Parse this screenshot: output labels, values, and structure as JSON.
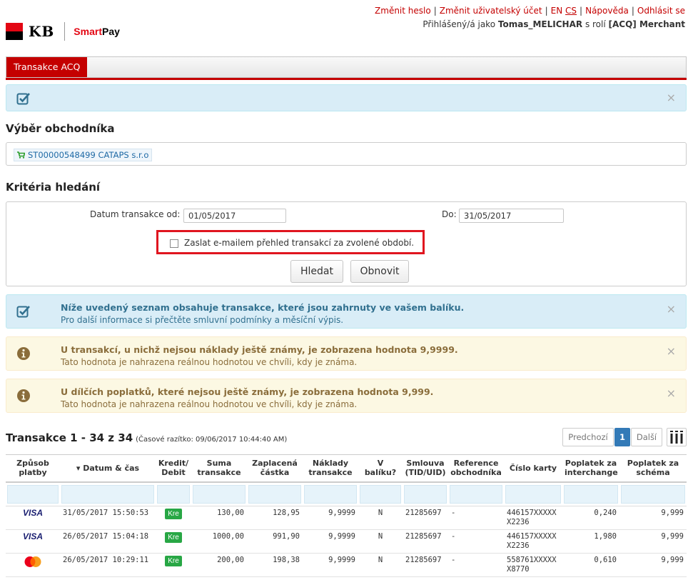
{
  "header": {
    "links": [
      "Změnit heslo",
      "Změnit uživatelský účet",
      "EN",
      "CS",
      "Nápověda",
      "Odhlásit se"
    ],
    "login_prefix": "Přihlášený/á jako",
    "login_user": "Tomas_MELICHAR",
    "login_mid": "s rolí",
    "login_role": "[ACQ] Merchant",
    "logo_kb": "KB",
    "logo_smart": "Smart",
    "logo_pay": "Pay"
  },
  "tabs": [
    "Transakce ACQ"
  ],
  "merchant": {
    "heading": "Výběr obchodníka",
    "chip": "ST00000548499 CATAPS s.r.o"
  },
  "search": {
    "heading": "Kritéria hledání",
    "from_label": "Datum transakce od:",
    "from_value": "01/05/2017",
    "to_label": "Do:",
    "to_value": "31/05/2017",
    "email_label": "Zaslat e-mailem přehled transakcí za zvolené období.",
    "search_button": "Hledat",
    "reset_button": "Obnovit"
  },
  "alerts": {
    "package_title": "Níže uvedený seznam obsahuje transakce, které jsou zahrnuty ve vašem balíku.",
    "package_text": "Pro další informace si přečtěte smluvní podmínky a měsíční výpis.",
    "costs_title": "U transakcí, u nichž nejsou náklady ještě známy, je zobrazena hodnota 9,9999.",
    "costs_text": "Tato hodnota je nahrazena reálnou hodnotou ve chvíli, kdy je známa.",
    "fees_title": "U dílčích poplatků, které nejsou ještě známy, je zobrazena hodnota 9,999.",
    "fees_text": "Tato hodnota je nahrazena reálnou hodnotou ve chvíli, kdy je známa.",
    "close": "×"
  },
  "transactions": {
    "title": "Transakce 1 - 34 z 34",
    "timestamp": "(Časové razítko: 09/06/2017 10:44:40 AM)",
    "pager_prev": "Predchozí",
    "pager_current": "1",
    "pager_next": "Další",
    "columns": {
      "payment": "Způsob platby",
      "datetime": "▾ Datum & čas",
      "credit": "Kredit/ Debit",
      "amount": "Suma transakce",
      "paid": "Zaplacená částka",
      "costs": "Náklady transakce",
      "package": "V balíku?",
      "contract": "Smlouva (TID/UID)",
      "reference": "Reference obchodníka",
      "card": "Číslo karty",
      "interchange": "Poplatek za interchange",
      "scheme": "Poplatek za schéma"
    },
    "rows": [
      {
        "brand": "VISA",
        "datetime": "31/05/2017 15:50:53",
        "cd": "Kre",
        "amount": "130,00",
        "paid": "128,95",
        "costs": "9,9999",
        "package": "N",
        "contract": "21285697",
        "reference": "-",
        "card": "446157XXXXX X2236",
        "interchange": "0,240",
        "scheme": "9,999"
      },
      {
        "brand": "VISA",
        "datetime": "26/05/2017 15:04:18",
        "cd": "Kre",
        "amount": "1000,00",
        "paid": "991,90",
        "costs": "9,9999",
        "package": "N",
        "contract": "21285697",
        "reference": "-",
        "card": "446157XXXXX X2236",
        "interchange": "1,980",
        "scheme": "9,999"
      },
      {
        "brand": "MasterCard",
        "datetime": "26/05/2017 10:29:11",
        "cd": "Kre",
        "amount": "200,00",
        "paid": "198,38",
        "costs": "9,9999",
        "package": "N",
        "contract": "21285697",
        "reference": "-",
        "card": "558761XXXXX X8770",
        "interchange": "0,610",
        "scheme": "9,999"
      }
    ]
  },
  "colors": {
    "brand_red": "#c40000",
    "info_bg": "#d9edf7",
    "warn_bg": "#fcf8e3",
    "highlight_border": "#e0151f",
    "badge_green": "#28a745"
  }
}
